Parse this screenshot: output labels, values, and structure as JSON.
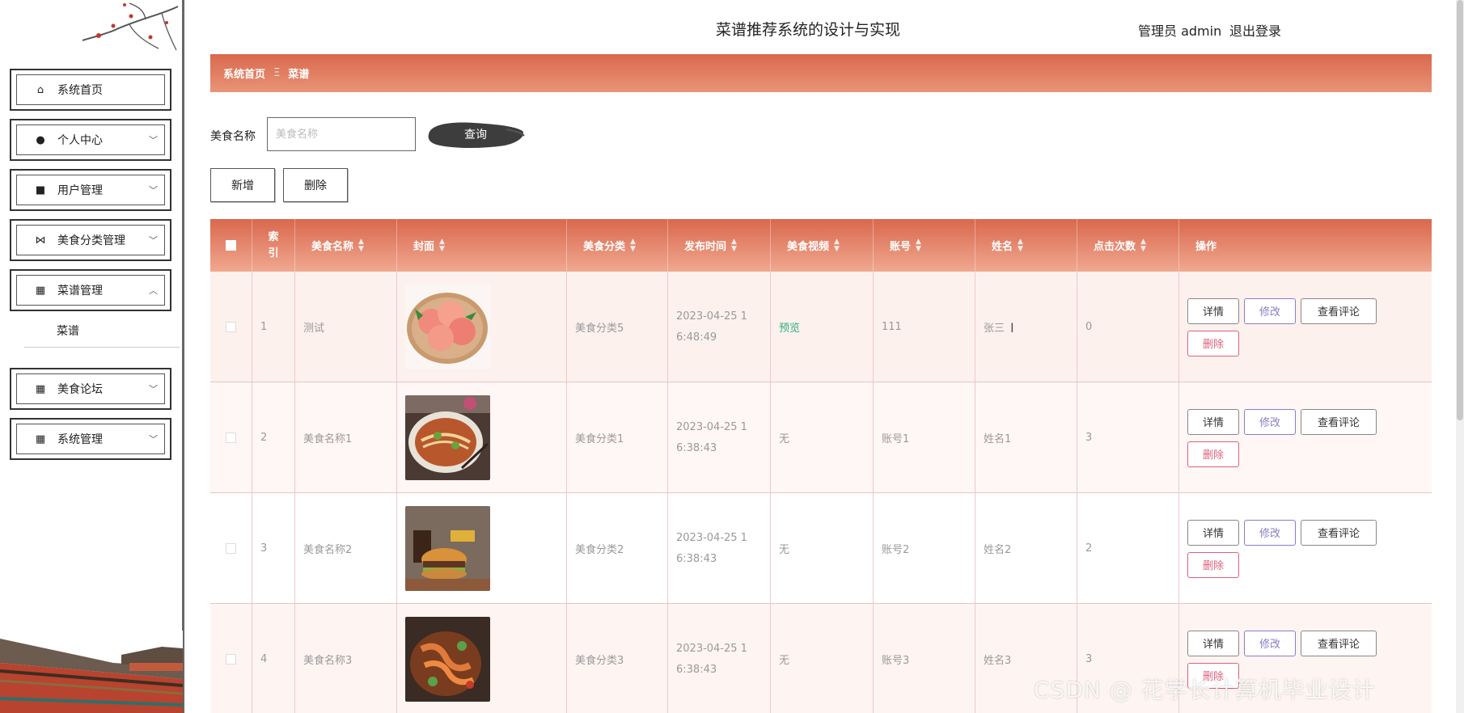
{
  "app": {
    "title": "菜谱推荐系统的设计与实现",
    "admin_label": "管理员 admin",
    "logout_label": "退出登录"
  },
  "sidebar": {
    "items": [
      {
        "label": "系统首页",
        "icon": "home-icon"
      },
      {
        "label": "个人中心",
        "icon": "user-icon"
      },
      {
        "label": "用户管理",
        "icon": "briefcase-icon"
      },
      {
        "label": "美食分类管理",
        "icon": "bow-icon"
      },
      {
        "label": "菜谱管理",
        "icon": "grid-icon"
      },
      {
        "label": "美食论坛",
        "icon": "grid-icon"
      },
      {
        "label": "系统管理",
        "icon": "grid-icon"
      }
    ],
    "submenu": {
      "label": "菜谱"
    }
  },
  "breadcrumb": {
    "home": "系统首页",
    "separator": "Ξ",
    "current": "菜谱"
  },
  "search": {
    "label": "美食名称",
    "placeholder": "美食名称",
    "button": "查询"
  },
  "actions": {
    "add": "新增",
    "delete": "删除"
  },
  "table": {
    "headers": {
      "index": "索引",
      "name": "美食名称",
      "cover": "封面",
      "category": "美食分类",
      "time": "发布时间",
      "video": "美食视频",
      "account": "账号",
      "realname": "姓名",
      "clicks": "点击次数",
      "ops": "操作"
    },
    "rows": [
      {
        "index": "1",
        "name": "测试",
        "category": "美食分类5",
        "time1": "2023-04-25 1",
        "time2": "6:48:49",
        "video": "预览",
        "account": "111",
        "realname": "张三",
        "clicks": "0",
        "cover_icon": "peach-image-icon"
      },
      {
        "index": "2",
        "name": "美食名称1",
        "category": "美食分类1",
        "time1": "2023-04-25 1",
        "time2": "6:38:43",
        "video": "无",
        "account": "账号1",
        "realname": "姓名1",
        "clicks": "3",
        "cover_icon": "noodle-image-icon"
      },
      {
        "index": "3",
        "name": "美食名称2",
        "category": "美食分类2",
        "time1": "2023-04-25 1",
        "time2": "6:38:43",
        "video": "无",
        "account": "账号2",
        "realname": "姓名2",
        "clicks": "2",
        "cover_icon": "burger-image-icon"
      },
      {
        "index": "4",
        "name": "美食名称3",
        "category": "美食分类3",
        "time1": "2023-04-25 1",
        "time2": "6:38:43",
        "video": "无",
        "account": "账号3",
        "realname": "姓名3",
        "clicks": "3",
        "cover_icon": "shrimp-image-icon"
      }
    ],
    "op_labels": {
      "detail": "详情",
      "edit": "修改",
      "comments": "查看评论",
      "delete": "删除"
    }
  },
  "watermark": "CSDN @ 花学长计算机毕业设计"
}
